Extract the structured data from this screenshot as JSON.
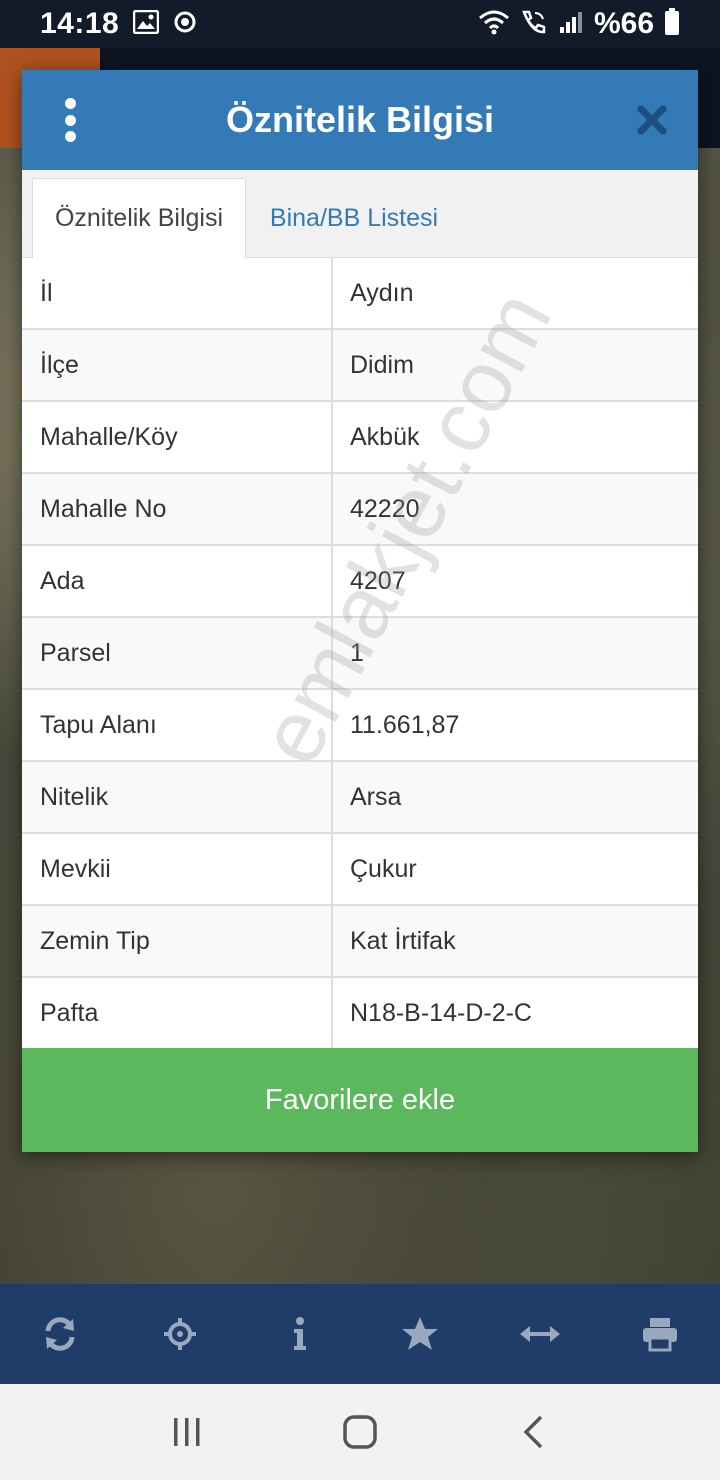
{
  "status_bar": {
    "time": "14:18",
    "battery": "%66",
    "icons_left": [
      "image-icon",
      "sync-icon"
    ],
    "icons_right": [
      "wifi-icon",
      "wifi-call-icon",
      "signal-icon",
      "battery-icon"
    ]
  },
  "dialog": {
    "title": "Öznitelik Bilgisi",
    "tabs": [
      {
        "label": "Öznitelik Bilgisi",
        "active": true
      },
      {
        "label": "Bina/BB Listesi",
        "active": false
      }
    ],
    "rows": [
      {
        "key": "İl",
        "value": "Aydın"
      },
      {
        "key": "İlçe",
        "value": "Didim"
      },
      {
        "key": "Mahalle/Köy",
        "value": "Akbük"
      },
      {
        "key": "Mahalle No",
        "value": "42220"
      },
      {
        "key": "Ada",
        "value": "4207"
      },
      {
        "key": "Parsel",
        "value": "1"
      },
      {
        "key": "Tapu Alanı",
        "value": "11.661,87"
      },
      {
        "key": "Nitelik",
        "value": "Arsa"
      },
      {
        "key": "Mevkii",
        "value": "Çukur"
      },
      {
        "key": "Zemin Tip",
        "value": "Kat İrtifak"
      },
      {
        "key": "Pafta",
        "value": "N18-B-14-D-2-C"
      }
    ],
    "favorite_button": "Favorilere ekle"
  },
  "watermark": "emlakjet.com",
  "toolbar": [
    "refresh-icon",
    "locate-icon",
    "info-icon",
    "star-icon",
    "measure-icon",
    "print-icon"
  ],
  "navbar": [
    "recent-apps-icon",
    "home-icon",
    "back-icon"
  ],
  "colors": {
    "header": "#337ab7",
    "favorite": "#5cb85c",
    "toolbar": "#1f3d68"
  }
}
